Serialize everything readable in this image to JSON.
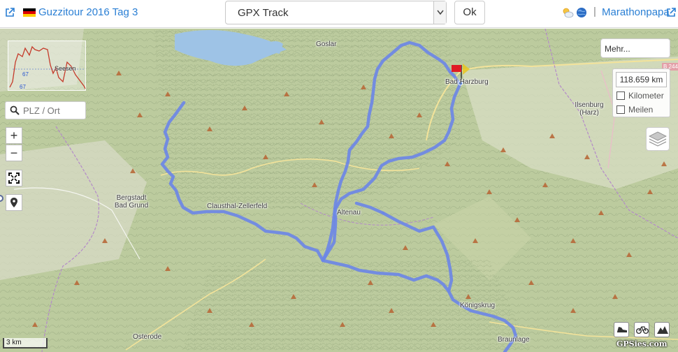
{
  "header": {
    "title": "Guzzitour 2016 Tag 3",
    "track_select_value": "GPX Track",
    "ok_label": "Ok",
    "separator": "|",
    "user": "Marathonpapa",
    "colors": {
      "link": "#2a7fd4"
    },
    "icons": [
      "external-link-icon",
      "germany-flag-icon",
      "weather-icon",
      "globe-icon"
    ]
  },
  "elevation": {
    "min_label": "67",
    "max_label": "67",
    "town": "Seesen"
  },
  "search": {
    "placeholder": "PLZ / Ort"
  },
  "controls": {
    "zoom_in": "+",
    "zoom_out": "−"
  },
  "more_label": "Mehr...",
  "distance": {
    "value": "118.659 km",
    "unit_km": "Kilometer",
    "unit_miles": "Meilen"
  },
  "map": {
    "route_color": "#6c87e6",
    "places": [
      "Goslar",
      "Bad Harzburg",
      "Ilsenburg (Harz)",
      "Bergstadt Bad Grund",
      "Clausthal-Zellerfeld",
      "Altenau",
      "Osterode",
      "Königskrug",
      "Braunlage"
    ],
    "road_label": "B 244"
  },
  "scale_label": "3 km",
  "brand": "GPSies.com"
}
